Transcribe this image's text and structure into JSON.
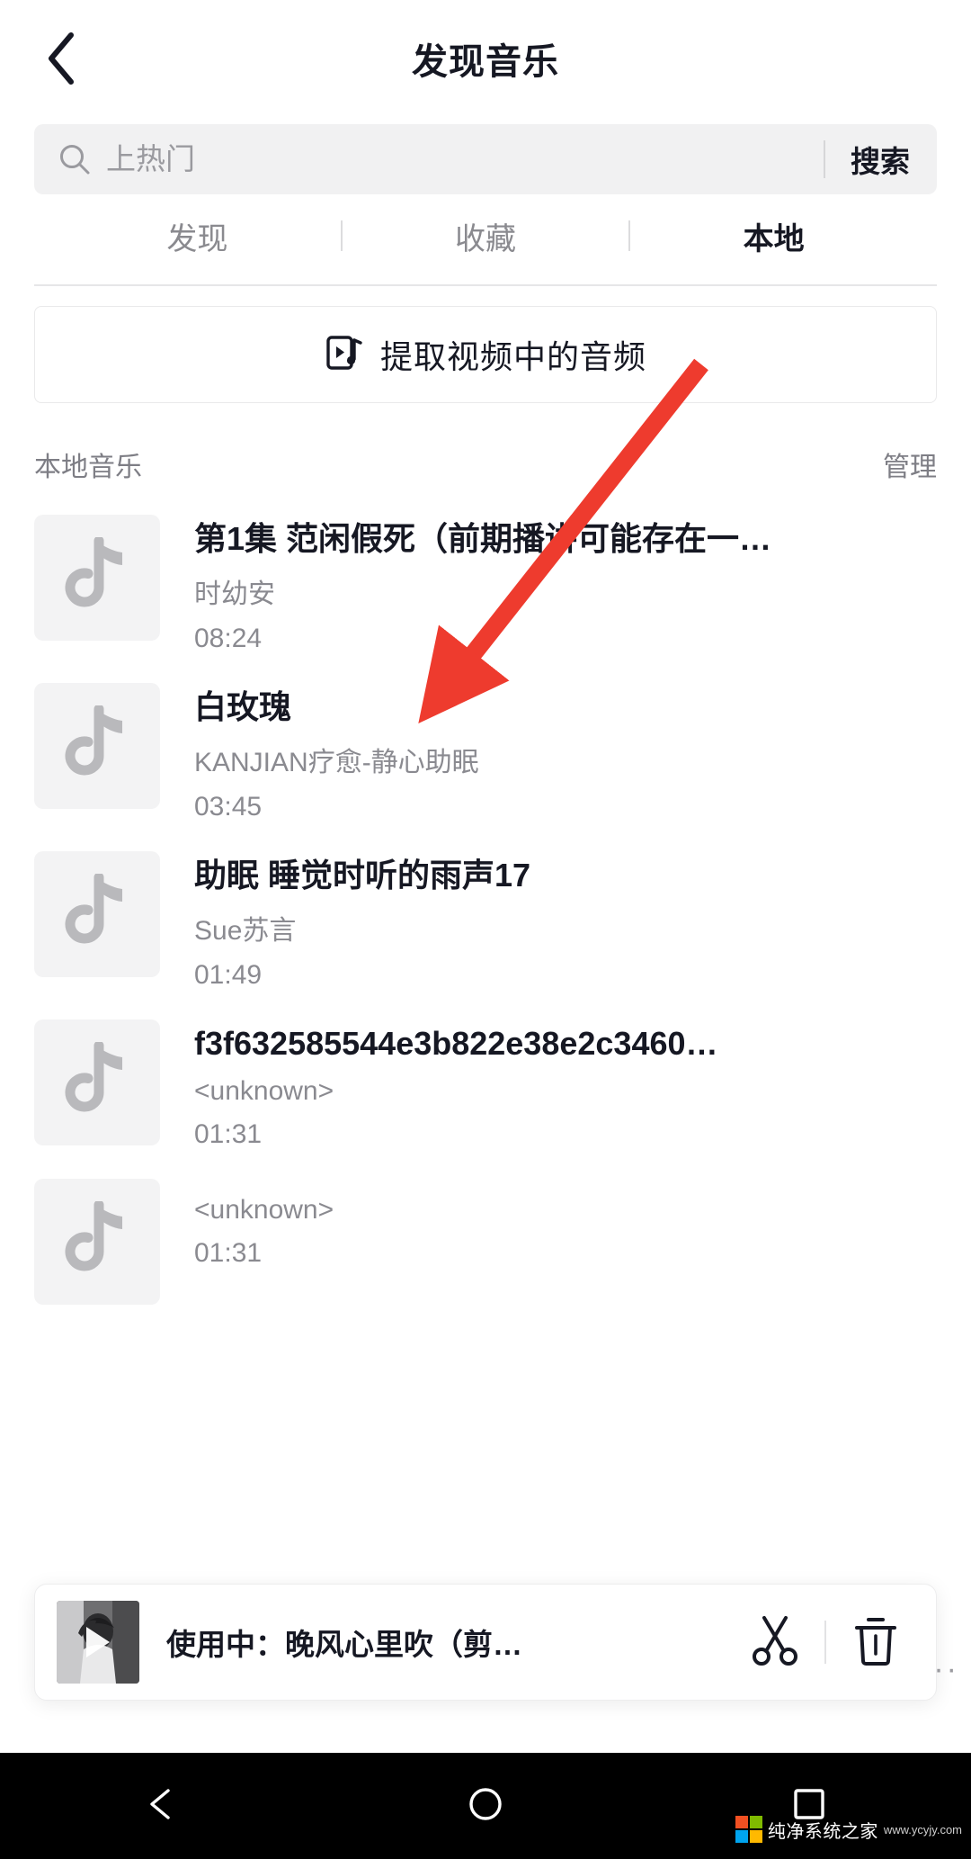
{
  "header": {
    "title": "发现音乐",
    "back_icon": "chevron-left-icon"
  },
  "search": {
    "placeholder": "上热门",
    "value": "",
    "icon": "search-icon",
    "button_label": "搜索"
  },
  "tabs": [
    {
      "label": "发现",
      "active": false
    },
    {
      "label": "收藏",
      "active": false
    },
    {
      "label": "本地",
      "active": true
    }
  ],
  "extract": {
    "label": "提取视频中的音频",
    "icon": "video-music-icon"
  },
  "section": {
    "title": "本地音乐",
    "manage_label": "管理"
  },
  "songs": [
    {
      "title": "第1集 范闲假死（前期播讲可能存在一…",
      "artist": "时幼安",
      "duration": "08:24",
      "icon": "music-note-icon"
    },
    {
      "title": "白玫瑰",
      "artist": "KANJIAN疗愈-静心助眠",
      "duration": "03:45",
      "icon": "music-note-icon"
    },
    {
      "title": "助眠 睡觉时听的雨声17",
      "artist": "Sue苏言",
      "duration": "01:49",
      "icon": "music-note-icon"
    },
    {
      "title": "f3f632585544e3b822e38e2c3460…",
      "artist": "<unknown>",
      "duration": "01:31",
      "icon": "music-note-icon"
    },
    {
      "title": "",
      "artist": "<unknown>",
      "duration": "01:31",
      "icon": "music-note-icon"
    }
  ],
  "player": {
    "text": "使用中：晚风心里吹（剪…",
    "play_icon": "play-icon",
    "cut_icon": "scissors-icon",
    "delete_icon": "trash-icon",
    "more_icon": "ellipsis-icon"
  },
  "navbar": [
    {
      "icon": "back-triangle-icon"
    },
    {
      "icon": "home-circle-icon"
    },
    {
      "icon": "recents-square-icon"
    }
  ],
  "watermark": {
    "text": "纯净系统之家",
    "sub": "www.ycyjy.com"
  },
  "colors": {
    "accent_red": "#ee3b2e",
    "text_primary": "#161823",
    "text_secondary": "#8a8a90",
    "surface": "#f1f1f2"
  }
}
